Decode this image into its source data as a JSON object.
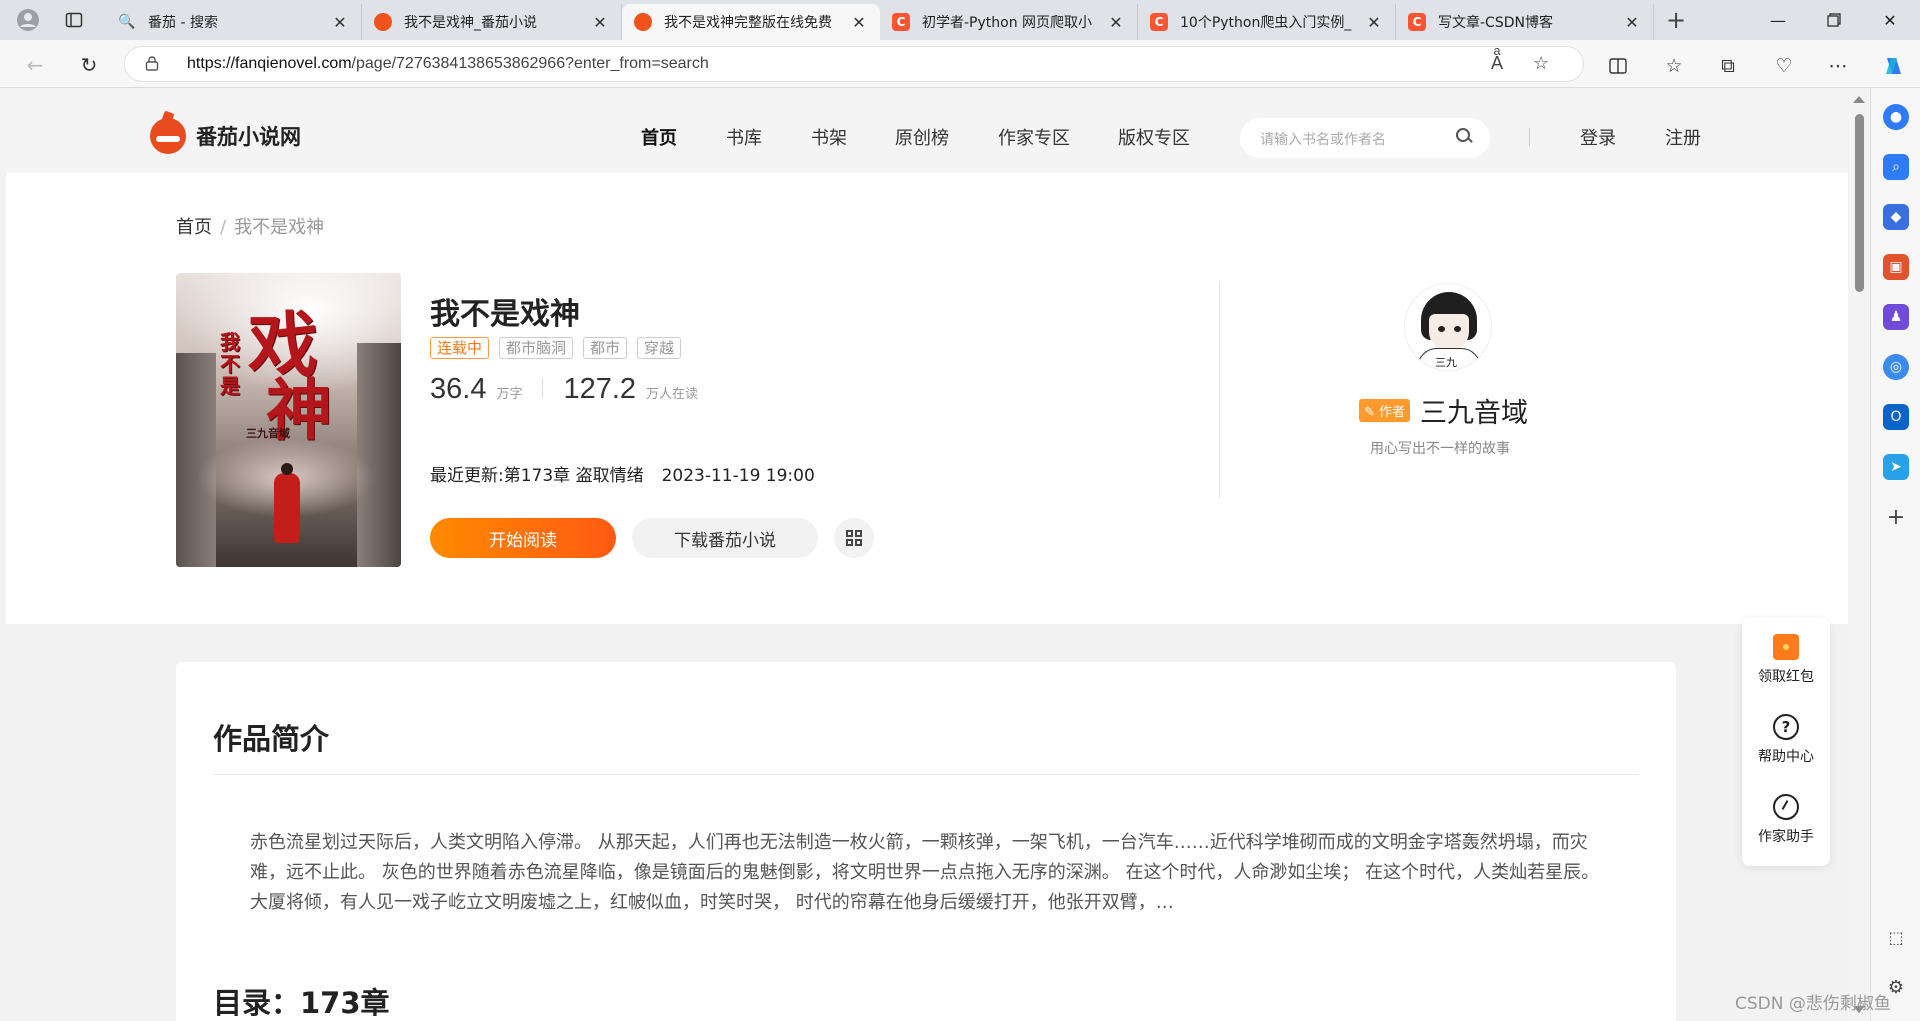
{
  "browser": {
    "tabs": [
      {
        "title": "番茄 - 搜索",
        "favicon": "search-icon",
        "active": false
      },
      {
        "title": "我不是戏神_番茄小说",
        "favicon": "fanqie-icon",
        "active": false
      },
      {
        "title": "我不是戏神完整版在线免费",
        "favicon": "fanqie-icon",
        "active": true
      },
      {
        "title": "初学者-Python 网页爬取小",
        "favicon": "csdn-icon",
        "active": false
      },
      {
        "title": "10个Python爬虫入门实例_",
        "favicon": "csdn-icon",
        "active": false
      },
      {
        "title": "写文章-CSDN博客",
        "favicon": "csdn-icon",
        "active": false
      }
    ],
    "url_host": "https://fanqienovel.com",
    "url_path": "/page/7276384138653862966?enter_from=search",
    "csdn_favicon_letter": "C",
    "accent_colors": {
      "fanqie": "#f0521c",
      "csdn": "#fc5531",
      "read_button": "#ff6a00"
    }
  },
  "site": {
    "logo_text": "番茄小说网",
    "nav": [
      "首页",
      "书库",
      "书架",
      "原创榜",
      "作家专区",
      "版权专区"
    ],
    "active_nav": "首页",
    "search_placeholder": "请输入书名或作者名",
    "login": "登录",
    "register": "注册"
  },
  "breadcrumb": {
    "home": "首页",
    "sep": "/",
    "current": "我不是戏神"
  },
  "book": {
    "cover_text": {
      "title_small": "我不是",
      "title_big_1": "戏",
      "title_big_2": "神",
      "author": "三九音域"
    },
    "title": "我不是戏神",
    "status": "连载中",
    "tags": [
      "都市脑洞",
      "都市",
      "穿越"
    ],
    "word_count": "36.4",
    "word_unit": "万字",
    "readers": "127.2",
    "readers_unit": "万人在读",
    "latest_label": "最近更新:",
    "latest_chapter": "第173章 盗取情绪",
    "latest_time": "2023-11-19 19:00",
    "read_button": "开始阅读",
    "download_button": "下载番茄小说"
  },
  "author": {
    "badge": "作者",
    "name": "三九音域",
    "motto": "用心写出不一样的故事",
    "avatar_sign": "三九"
  },
  "intro": {
    "title": "作品简介",
    "text": "赤色流星划过天际后，人类文明陷入停滞。 从那天起，人们再也无法制造一枚火箭，一颗核弹，一架飞机，一台汽车……近代科学堆砌而成的文明金字塔轰然坍塌，而灾难，远不止此。 灰色的世界随着赤色流星降临，像是镜面后的鬼魅倒影，将文明世界一点点拖入无序的深渊。 在这个时代，人命渺如尘埃； 在这个时代，人类灿若星辰。 大厦将倾，有人见一戏子屹立文明废墟之上，红帔似血，时笑时哭， 时代的帘幕在他身后缓缓打开，他张开双臂，…",
    "toc_title": "目录：173章"
  },
  "float_panel": [
    {
      "label": "领取红包",
      "icon": "red-packet-icon"
    },
    {
      "label": "帮助中心",
      "icon": "help-icon"
    },
    {
      "label": "作家助手",
      "icon": "writer-assistant-icon"
    }
  ],
  "watermark": "CSDN @悲伤剩椒鱼"
}
